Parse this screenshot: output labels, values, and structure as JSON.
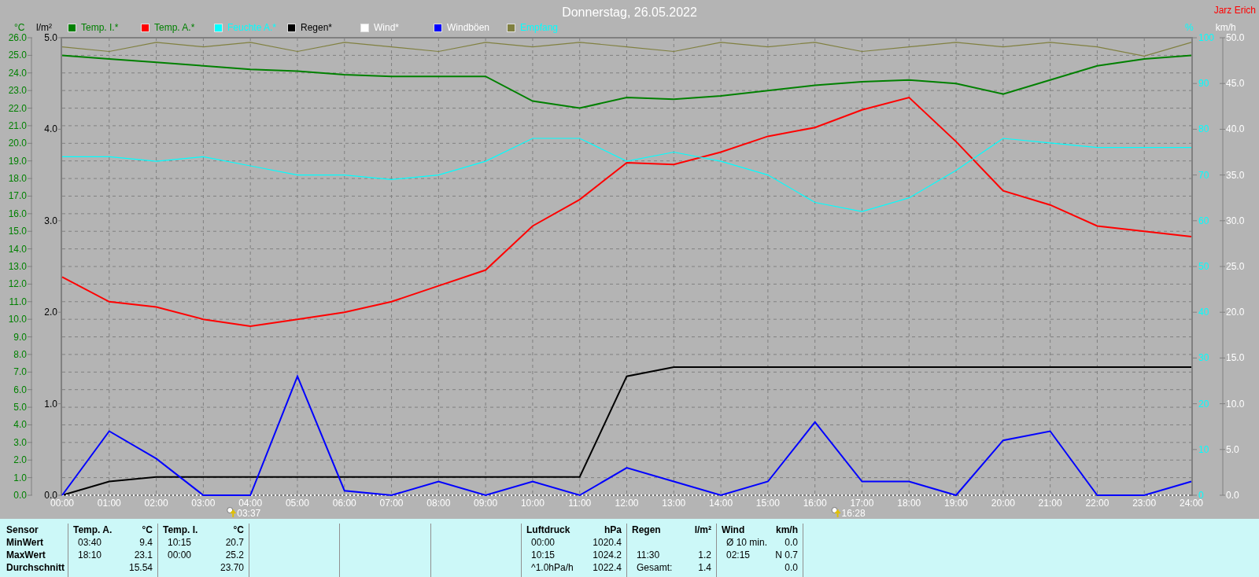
{
  "title": "Donnerstag, 26.05.2022",
  "author": "Jarz Erich",
  "charts": [
    {
      "chart_data": {
        "type": "line",
        "ylabel": "°C",
        "x": [
          0,
          1,
          2,
          3,
          4,
          5,
          6,
          7,
          8,
          9,
          10,
          11,
          12,
          13,
          14,
          15,
          16,
          17,
          18,
          19,
          20,
          21,
          22,
          23,
          24
        ],
        "xlim": [
          0,
          24
        ],
        "xticks": [
          {
            "value": 0,
            "label": "00:00"
          },
          {
            "value": 1,
            "label": "01:00"
          },
          {
            "value": 2,
            "label": "02:00"
          },
          {
            "value": 3,
            "label": "03:00"
          },
          {
            "value": 4,
            "label": "04:00"
          },
          {
            "value": 5,
            "label": "05:00"
          },
          {
            "value": 6,
            "label": "06:00"
          },
          {
            "value": 7,
            "label": "07:00"
          },
          {
            "value": 8,
            "label": "08:00"
          },
          {
            "value": 9,
            "label": "09:00"
          },
          {
            "value": 10,
            "label": "10:00"
          },
          {
            "value": 11,
            "label": "11:00"
          },
          {
            "value": 12,
            "label": "12:00"
          },
          {
            "value": 13,
            "label": "13:00"
          },
          {
            "value": 14,
            "label": "14:00"
          },
          {
            "value": 15,
            "label": "15:00"
          },
          {
            "value": 16,
            "label": "16:00"
          },
          {
            "value": 17,
            "label": "17:00"
          },
          {
            "value": 18,
            "label": "18:00"
          },
          {
            "value": 19,
            "label": "19:00"
          },
          {
            "value": 20,
            "label": "20:00"
          },
          {
            "value": 21,
            "label": "21:00"
          },
          {
            "value": 22,
            "label": "22:00"
          },
          {
            "value": 23,
            "label": "23:00"
          },
          {
            "value": 24,
            "label": "24:00"
          }
        ],
        "ylim": [
          0,
          26
        ],
        "yticks": [
          {
            "value": 0,
            "label": "0.0"
          },
          {
            "value": 1,
            "label": "1.0"
          },
          {
            "value": 2,
            "label": "2.0"
          },
          {
            "value": 3,
            "label": "3.0"
          },
          {
            "value": 4,
            "label": "4.0"
          },
          {
            "value": 5,
            "label": "5.0"
          },
          {
            "value": 6,
            "label": "6.0"
          },
          {
            "value": 7,
            "label": "7.0"
          },
          {
            "value": 8,
            "label": "8.0"
          },
          {
            "value": 9,
            "label": "9.0"
          },
          {
            "value": 10,
            "label": "10.0"
          },
          {
            "value": 11,
            "label": "11.0"
          },
          {
            "value": 12,
            "label": "12.0"
          },
          {
            "value": 13,
            "label": "13.0"
          },
          {
            "value": 14,
            "label": "14.0"
          },
          {
            "value": 15,
            "label": "15.0"
          },
          {
            "value": 16,
            "label": "16.0"
          },
          {
            "value": 17,
            "label": "17.0"
          },
          {
            "value": 18,
            "label": "18.0"
          },
          {
            "value": 19,
            "label": "19.0"
          },
          {
            "value": 20,
            "label": "20.0"
          },
          {
            "value": 21,
            "label": "21.0"
          },
          {
            "value": 22,
            "label": "22.0"
          },
          {
            "value": 23,
            "label": "23.0"
          },
          {
            "value": 24,
            "label": "24.0"
          },
          {
            "value": 25,
            "label": "25.0"
          },
          {
            "value": 26,
            "label": "26.0"
          }
        ],
        "series": [
          {
            "name": "Temp. I.*",
            "color": "#008000",
            "values": [
              25.0,
              24.8,
              24.6,
              24.4,
              24.2,
              24.1,
              23.9,
              23.8,
              23.8,
              23.8,
              22.4,
              22.0,
              22.6,
              22.5,
              22.7,
              23.0,
              23.3,
              23.5,
              23.6,
              23.4,
              22.8,
              23.6,
              24.4,
              24.8,
              25.0
            ]
          },
          {
            "name": "Temp. A.*",
            "color": "#ff0000",
            "values": [
              12.4,
              11.0,
              10.7,
              10.0,
              9.6,
              10.0,
              10.4,
              11.0,
              11.9,
              12.8,
              15.3,
              16.8,
              18.9,
              18.8,
              19.5,
              20.4,
              20.9,
              21.9,
              22.6,
              20.1,
              17.3,
              16.5,
              15.3,
              15.0,
              14.7
            ]
          },
          {
            "name": "Feuchte A.*",
            "color": "#00ffff",
            "axis": "y2",
            "values": [
              74,
              74,
              73,
              74,
              72,
              70,
              70,
              69,
              70,
              73,
              78,
              78,
              73,
              75,
              73,
              70,
              64,
              62,
              65,
              71,
              78,
              77,
              76,
              76,
              76
            ]
          },
          {
            "name": "Empfang",
            "color": "#808040",
            "axis": "y2",
            "values": [
              98,
              97,
              99,
              98,
              99,
              97,
              99,
              98,
              97,
              99,
              98,
              99,
              98,
              97,
              99,
              98,
              99,
              97,
              98,
              99,
              98,
              99,
              98,
              96,
              99
            ]
          }
        ],
        "annotations": [
          "03:37",
          "16:28"
        ],
        "y2label": "%",
        "y2lim": [
          0,
          100
        ],
        "y2ticks": [
          0,
          10,
          20,
          30,
          40,
          50,
          60,
          70,
          80,
          90,
          100
        ]
      }
    },
    {
      "chart_data": {
        "type": "line",
        "ylabel": "l/m²",
        "x": [
          0,
          1,
          2,
          3,
          4,
          5,
          6,
          7,
          8,
          9,
          10,
          11,
          12,
          13,
          14,
          15,
          16,
          17,
          18,
          19,
          20,
          21,
          22,
          23,
          24
        ],
        "xlim": [
          0,
          24
        ],
        "ylim": [
          0,
          5
        ],
        "yticks": [
          {
            "value": 0,
            "label": "0.0"
          },
          {
            "value": 1,
            "label": "1.0"
          },
          {
            "value": 2,
            "label": "2.0"
          },
          {
            "value": 3,
            "label": "3.0"
          },
          {
            "value": 4,
            "label": "4.0"
          },
          {
            "value": 5,
            "label": "5.0"
          }
        ],
        "series": [
          {
            "name": "Regen*",
            "color": "#000000",
            "values": [
              0,
              0.15,
              0.2,
              0.2,
              0.2,
              0.2,
              0.2,
              0.2,
              0.2,
              0.2,
              0.2,
              0.2,
              1.3,
              1.4,
              1.4,
              1.4,
              1.4,
              1.4,
              1.4,
              1.4,
              1.4,
              1.4,
              1.4,
              1.4,
              1.4
            ]
          },
          {
            "name": "Wind*",
            "color": "#ffffff",
            "axis": "y2",
            "line_style": "dotted",
            "values": [
              0,
              0,
              0,
              0,
              0,
              0,
              0,
              0,
              0,
              0,
              0,
              0,
              0,
              0,
              0,
              0,
              0,
              0,
              0,
              0,
              0,
              0,
              0,
              0,
              0
            ]
          },
          {
            "name": "Windböen",
            "color": "#0000ff",
            "axis": "y2",
            "values": [
              0,
              7,
              4,
              0,
              0,
              13,
              0.5,
              0,
              1.5,
              0,
              1.5,
              0,
              3,
              1.5,
              0,
              1.5,
              8,
              1.5,
              1.5,
              0,
              6,
              7,
              0,
              0,
              1.5
            ]
          }
        ],
        "y2label": "km/h",
        "y2lim": [
          0,
          50
        ],
        "y2ticks": [
          {
            "value": 0,
            "label": "0.0"
          },
          {
            "value": 5,
            "label": "5.0"
          },
          {
            "value": 10,
            "label": "10.0"
          },
          {
            "value": 15,
            "label": "15.0"
          },
          {
            "value": 20,
            "label": "20.0"
          },
          {
            "value": 25,
            "label": "25.0"
          },
          {
            "value": 30,
            "label": "30.0"
          },
          {
            "value": 35,
            "label": "35.0"
          },
          {
            "value": 40,
            "label": "40.0"
          },
          {
            "value": 45,
            "label": "45.0"
          },
          {
            "value": 50,
            "label": "50.0"
          }
        ]
      }
    }
  ],
  "stats": {
    "label_column": {
      "title": "Sensor",
      "rows": [
        "MinWert",
        "MaxWert",
        "Durchschnitt"
      ]
    },
    "panels": [
      {
        "kind": "data",
        "title": "Temp. A.",
        "unit": "°C",
        "rows": [
          {
            "time": "03:40",
            "value": "9.4"
          },
          {
            "time": "18:10",
            "value": "23.1"
          },
          {
            "value": "15.54"
          }
        ]
      },
      {
        "kind": "data",
        "title": "Temp. I.",
        "unit": "°C",
        "rows": [
          {
            "time": "10:15",
            "value": "20.7"
          },
          {
            "time": "00:00",
            "value": "25.2"
          },
          {
            "value": "23.70"
          }
        ]
      },
      {
        "kind": "empty"
      },
      {
        "kind": "empty"
      },
      {
        "kind": "empty"
      },
      {
        "kind": "data",
        "title": "Luftdruck",
        "unit": "hPa",
        "rows": [
          {
            "time": "00:00",
            "value": "1020.4"
          },
          {
            "time": "10:15",
            "value": "1024.2"
          },
          {
            "time": "^1.0hPa/h",
            "value": "1022.4"
          }
        ]
      },
      {
        "kind": "data",
        "title": "Regen",
        "unit": "l/m²",
        "rows": [
          {},
          {
            "time": "11:30",
            "value": "1.2"
          },
          {
            "time": "Gesamt:",
            "value": "1.4"
          }
        ]
      },
      {
        "kind": "data",
        "title": "Wind",
        "unit": "km/h",
        "rows": [
          {
            "time": "Ø 10 min.",
            "value": "0.0"
          },
          {
            "time": "02:15",
            "value": "N 0.7"
          },
          {
            "value": "0.0"
          }
        ]
      }
    ]
  }
}
